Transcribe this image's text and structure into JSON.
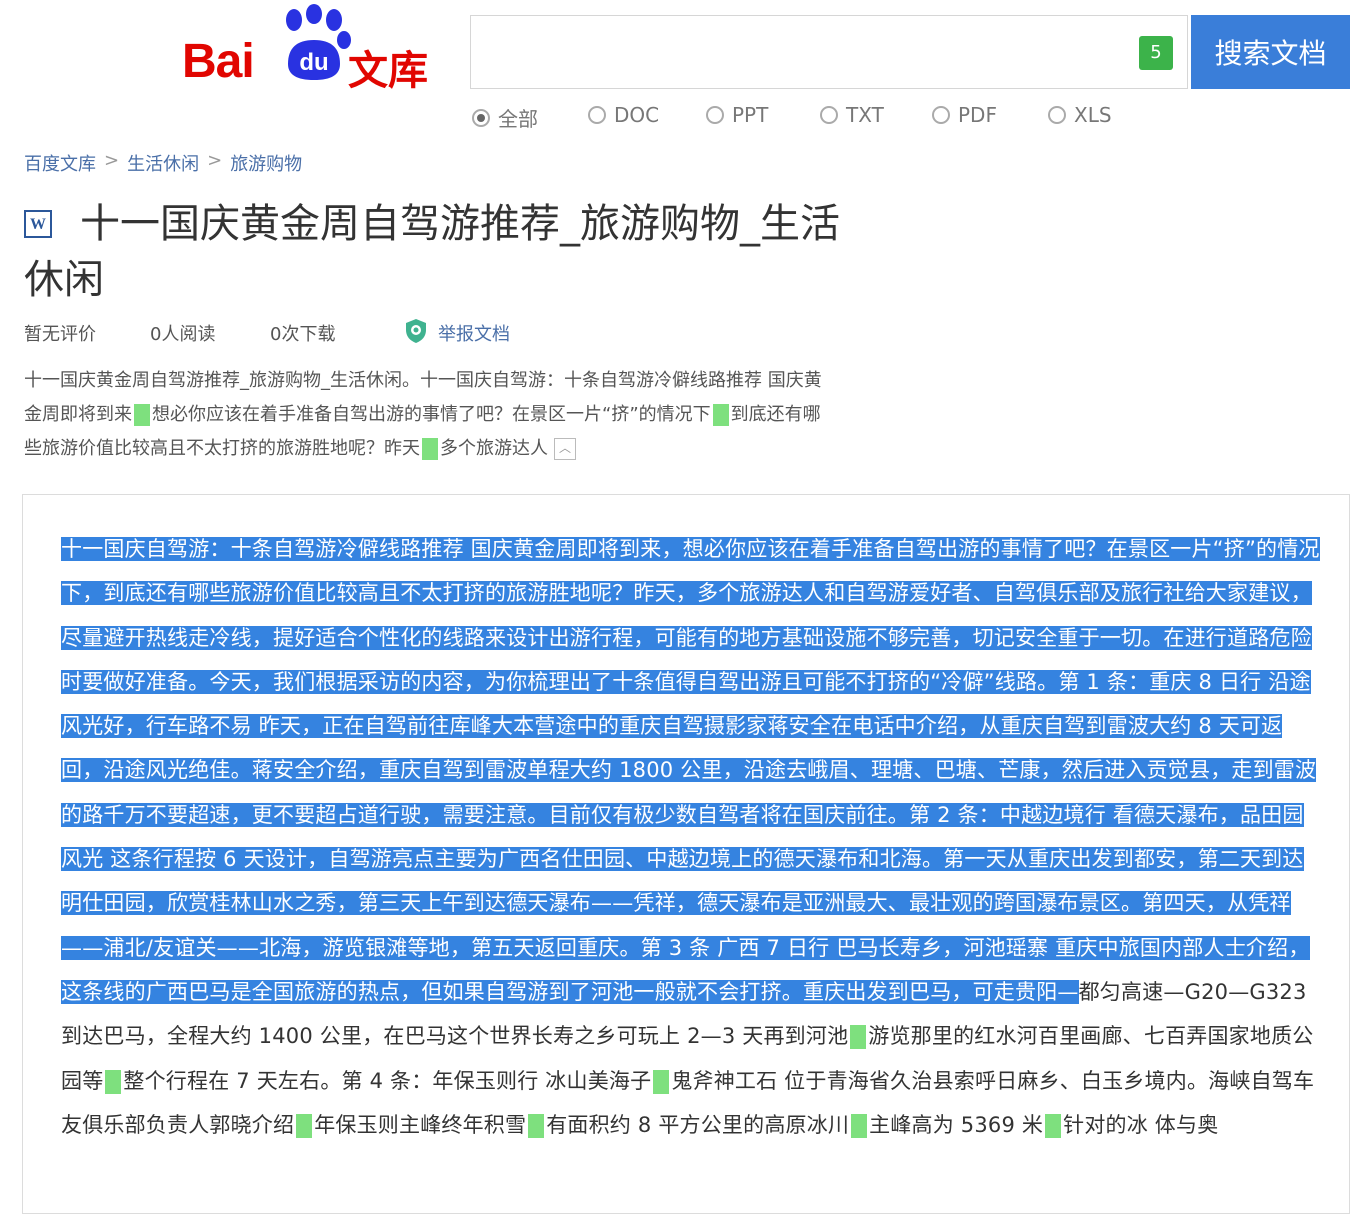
{
  "header": {
    "logo_text_bai": "Bai",
    "logo_text_du": "du",
    "logo_text_wenku": "文库",
    "search_value": "",
    "ime_badge": "5",
    "search_button": "搜索文档"
  },
  "filters": [
    {
      "label": "全部",
      "selected": true
    },
    {
      "label": "DOC",
      "selected": false
    },
    {
      "label": "PPT",
      "selected": false
    },
    {
      "label": "TXT",
      "selected": false
    },
    {
      "label": "PDF",
      "selected": false
    },
    {
      "label": "XLS",
      "selected": false
    }
  ],
  "breadcrumb": [
    "百度文库",
    "生活休闲",
    "旅游购物"
  ],
  "breadcrumb_separator": ">",
  "doc": {
    "icon_letter": "W",
    "title": "十一国庆黄金周自驾游推荐_旅游购物_生活休闲",
    "rating": "暂无评价",
    "reads": "0人阅读",
    "downloads": "0次下载",
    "report": "举报文档",
    "summary": {
      "p1": "十一国庆黄金周自驾游推荐_旅游购物_生活休闲。十一国庆自驾游：十条自驾游冷僻线路推荐 国庆黄金周即将到来",
      "p2": "想必你应该在着手准备自驾出游的事情了吧？在景区一片“挤”的情况下",
      "p3": "到底还有哪些旅游价值比较高且不太打挤的旅游胜地呢？昨天",
      "p4": "多个旅游达人"
    },
    "body": {
      "selected": "十一国庆自驾游：十条自驾游冷僻线路推荐 国庆黄金周即将到来，想必你应该在着手准备自驾出游的事情了吧？在景区一片“挤”的情况下，到底还有哪些旅游价值比较高且不太打挤的旅游胜地呢？昨天，多个旅游达人和自驾游爱好者、自驾俱乐部及旅行社给大家建议，尽量避开热线走冷线，提好适合个性化的线路来设计出游行程，可能有的地方基础设施不够完善，切记安全重于一切。在进行道路危险时要做好准备。今天，我们根据采访的内容，为你梳理出了十条值得自驾出游且可能不打挤的“冷僻”线路。第 1 条：重庆 8 日行 沿途风光好，行车路不易 昨天，正在自驾前往库峰大本营途中的重庆自驾摄影家蒋安全在电话中介绍，从重庆自驾到雷波大约 8 天可返回，沿途风光绝佳。蒋安全介绍，重庆自驾到雷波单程大约 1800 公里，沿途去峨眉、理塘、巴塘、芒康，然后进入贡觉县，走到雷波的路千万不要超速，更不要超占道行驶，需要注意。目前仅有极少数自驾者将在国庆前往。第 2 条：中越边境行 看德天瀑布，品田园风光 这条行程按 6 天设计，自驾游亮点主要为广西名仕田园、中越边境上的德天瀑布和北海。第一天从重庆出发到都安，第二天到达明仕田园，欣赏桂林山水之秀，第三天上午到达德天瀑布——凭祥，德天瀑布是亚洲最大、最壮观的跨国瀑布景区。第四天，从凭祥——浦北/友谊关——北海，游览银滩等地，第五天返回重庆。第 3 条 广西 7 日行 巴马长寿乡，河池瑶寨 重庆中旅国内部人士介绍，这条线的广西巴马是全国旅游的热点，但如果自驾游到了河池一般就不会打挤。重庆出发到巴马，可走贵阳—",
      "unselected_1": "都匀高速—G20—G323 到达巴马，全程大约 1400 公里，在巴马这个世界长寿之乡可玩上 2—3 天再到河池",
      "unselected_2": "游览那里的红水河百里画廊、七百弄国家地质公园等",
      "unselected_3": "整个行程在 7 天左右。第 4 条：年保玉则行 冰山美海子",
      "unselected_4": "鬼斧神工石 位于青海省久治县索呼日麻乡、白玉乡境内。海峡自驾车友俱乐部负责人郭晓介绍",
      "unselected_5": "年保玉则主峰终年积雪",
      "unselected_6": "有面积约 8 平方公里的高原冰川",
      "unselected_7": "主峰高为 5369 米",
      "unselected_8": "针对的冰 体与奥"
    }
  },
  "colors": {
    "logo_red": "#e10601",
    "logo_blue": "#2932e1",
    "search_button_bg": "#3a7ed9",
    "selection_bg": "#3583e0",
    "highlight_green": "#7ee07e",
    "ime_badge_bg": "#3cb34a"
  },
  "icons": {
    "logo": "baidu-paw-icon",
    "doc_type": "word-doc-icon",
    "report": "shield-icon",
    "collapse": "chevron-up-icon"
  }
}
